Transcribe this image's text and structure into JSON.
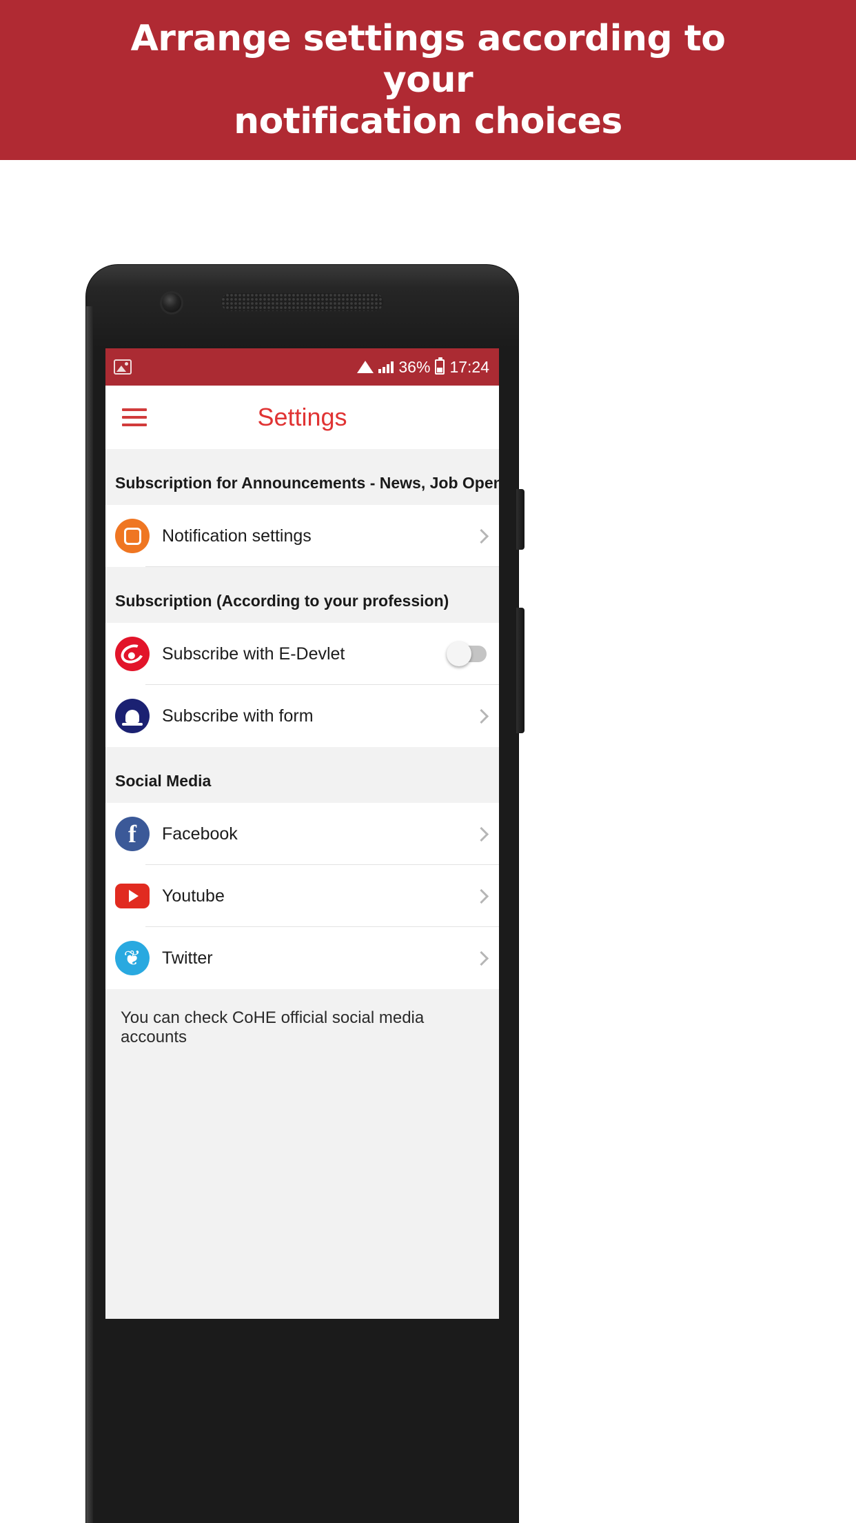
{
  "promo": {
    "headline_line1": "Arrange settings according to your",
    "headline_line2": "notification choices",
    "background_color": "#b02a33",
    "text_color": "#ffffff"
  },
  "phone": {
    "status_bar": {
      "background_color": "#ab2b33",
      "notification_icon": "photo-icon",
      "wifi_icon": "wifi-icon",
      "signal_icon": "signal-bars-icon",
      "battery_percent": "36%",
      "battery_icon": "battery-icon",
      "time": "17:24"
    },
    "app_bar": {
      "menu_icon": "hamburger-menu-icon",
      "title": "Settings",
      "title_color": "#e03333"
    },
    "sections": [
      {
        "header": "Subscription for Announcements - News, Job Openings",
        "rows": [
          {
            "icon": "notification-settings-icon",
            "icon_color": "#ef7622",
            "label": "Notification settings",
            "accessory": "chevron-right-icon"
          }
        ]
      },
      {
        "header": "Subscription (According to your profession)",
        "rows": [
          {
            "icon": "e-devlet-icon",
            "icon_color": "#e2142a",
            "label": "Subscribe with E-Devlet",
            "accessory": "toggle-switch",
            "toggle_state": "off"
          },
          {
            "icon": "bell-icon",
            "icon_color": "#1b2172",
            "label": "Subscribe with form",
            "accessory": "chevron-right-icon"
          }
        ]
      },
      {
        "header": "Social Media",
        "rows": [
          {
            "icon": "facebook-icon",
            "icon_color": "#3b5998",
            "icon_glyph": "f",
            "label": "Facebook",
            "accessory": "chevron-right-icon"
          },
          {
            "icon": "youtube-icon",
            "icon_color": "#e12b20",
            "label": "Youtube",
            "accessory": "chevron-right-icon"
          },
          {
            "icon": "twitter-icon",
            "icon_color": "#29a9e0",
            "icon_glyph": "❦",
            "label": "Twitter",
            "accessory": "chevron-right-icon"
          }
        ]
      }
    ],
    "footer_note": "You can check CoHE official social media accounts"
  }
}
